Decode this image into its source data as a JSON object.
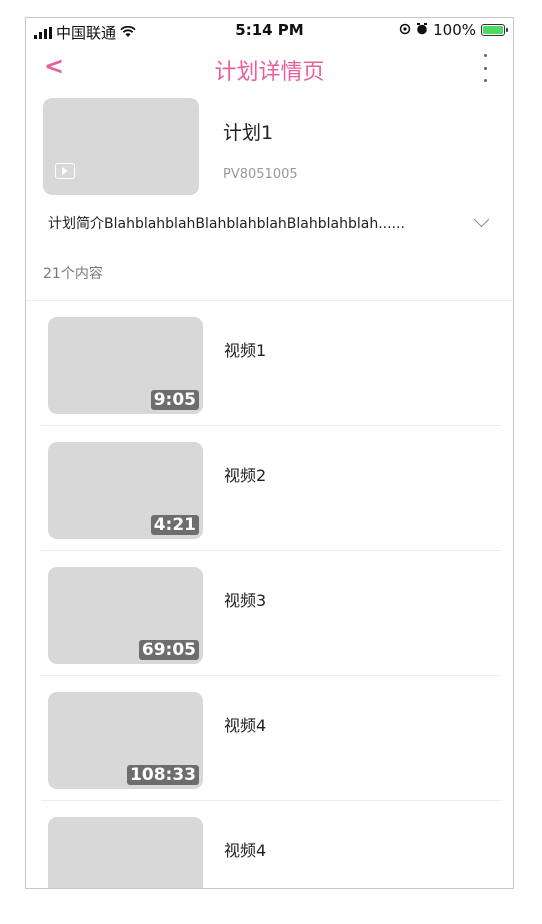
{
  "status_bar": {
    "carrier": "中国联通",
    "time": "5:14 PM",
    "battery": "100%"
  },
  "nav": {
    "back": "<",
    "title": "计划详情页"
  },
  "plan": {
    "title": "计划1",
    "code": "PV8051005",
    "description": "计划简介BlahblahblahBlahblahblahBlahblahblah......",
    "count": "21个内容"
  },
  "videos": [
    {
      "title": "视频1",
      "duration": "9:05"
    },
    {
      "title": "视频2",
      "duration": "4:21"
    },
    {
      "title": "视频3",
      "duration": "69:05"
    },
    {
      "title": "视频4",
      "duration": "108:33"
    },
    {
      "title": "视频4",
      "duration": ""
    }
  ],
  "colors": {
    "accent": "#e8609b",
    "thumb": "#d8d8d8",
    "duration_badge": "#6d6d6d"
  }
}
